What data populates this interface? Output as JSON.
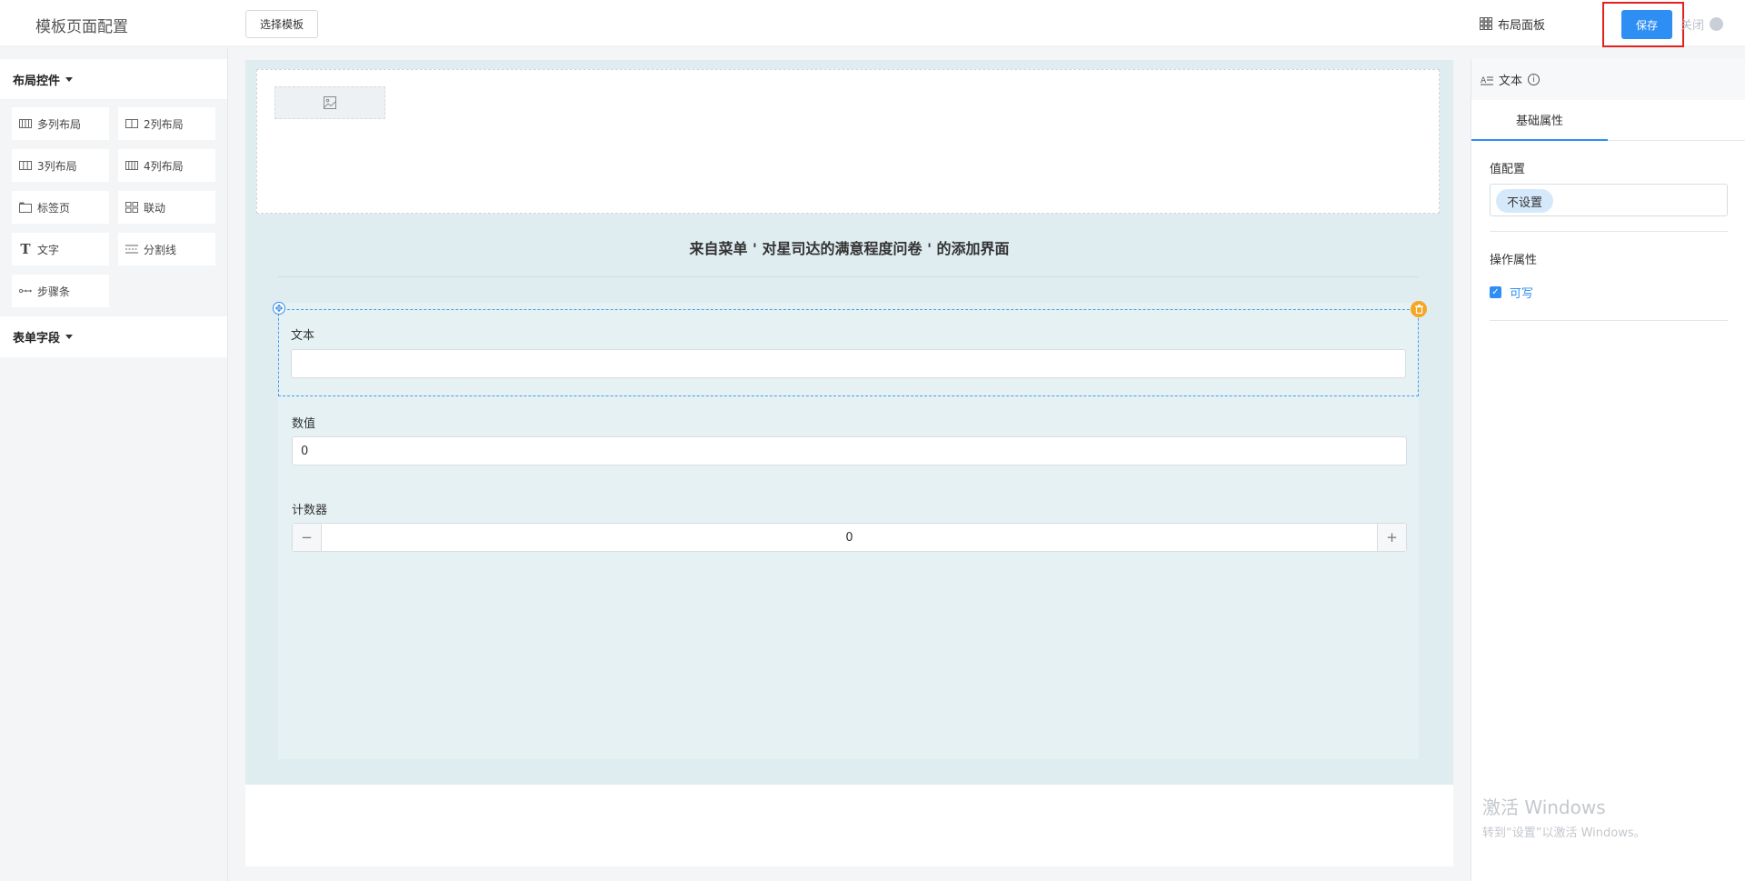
{
  "header": {
    "title": "模板页面配置",
    "select_template_label": "选择模板",
    "layout_panel_label": "布局面板",
    "save_label": "保存",
    "close_label": "关闭"
  },
  "left_panel": {
    "layout_controls_title": "布局控件",
    "widgets": [
      {
        "label": "多列布局",
        "icon": "columns-icon"
      },
      {
        "label": "2列布局",
        "icon": "two-columns-icon"
      },
      {
        "label": "3列布局",
        "icon": "three-columns-icon"
      },
      {
        "label": "4列布局",
        "icon": "four-columns-icon"
      },
      {
        "label": "标签页",
        "icon": "tab-icon"
      },
      {
        "label": "联动",
        "icon": "grid-icon"
      },
      {
        "label": "文字",
        "icon": "text-icon"
      },
      {
        "label": "分割线",
        "icon": "divider-icon"
      },
      {
        "label": "步骤条",
        "icon": "steps-icon"
      }
    ],
    "form_fields_title": "表单字段"
  },
  "canvas": {
    "form_title": "来自菜单 ' 对星司达的满意程度问卷 ' 的添加界面",
    "fields": {
      "text": {
        "label": "文本",
        "value": ""
      },
      "number": {
        "label": "数值",
        "value": "0"
      },
      "counter": {
        "label": "计数器",
        "value": "0",
        "minus": "−",
        "plus": "+"
      }
    }
  },
  "right_panel": {
    "component_name": "文本",
    "tab_basic": "基础属性",
    "value_config_title": "值配置",
    "value_config_tag": "不设置",
    "operation_title": "操作属性",
    "writable_label": "可写",
    "writable_checked": true
  },
  "watermark": {
    "title": "激活 Windows",
    "subtitle": "转到“设置”以激活 Windows。"
  },
  "colors": {
    "accent": "#2f8ef4",
    "highlight_border": "#e3201b",
    "canvas_bg": "#dfecf0",
    "delete_handle": "#f5a623"
  }
}
